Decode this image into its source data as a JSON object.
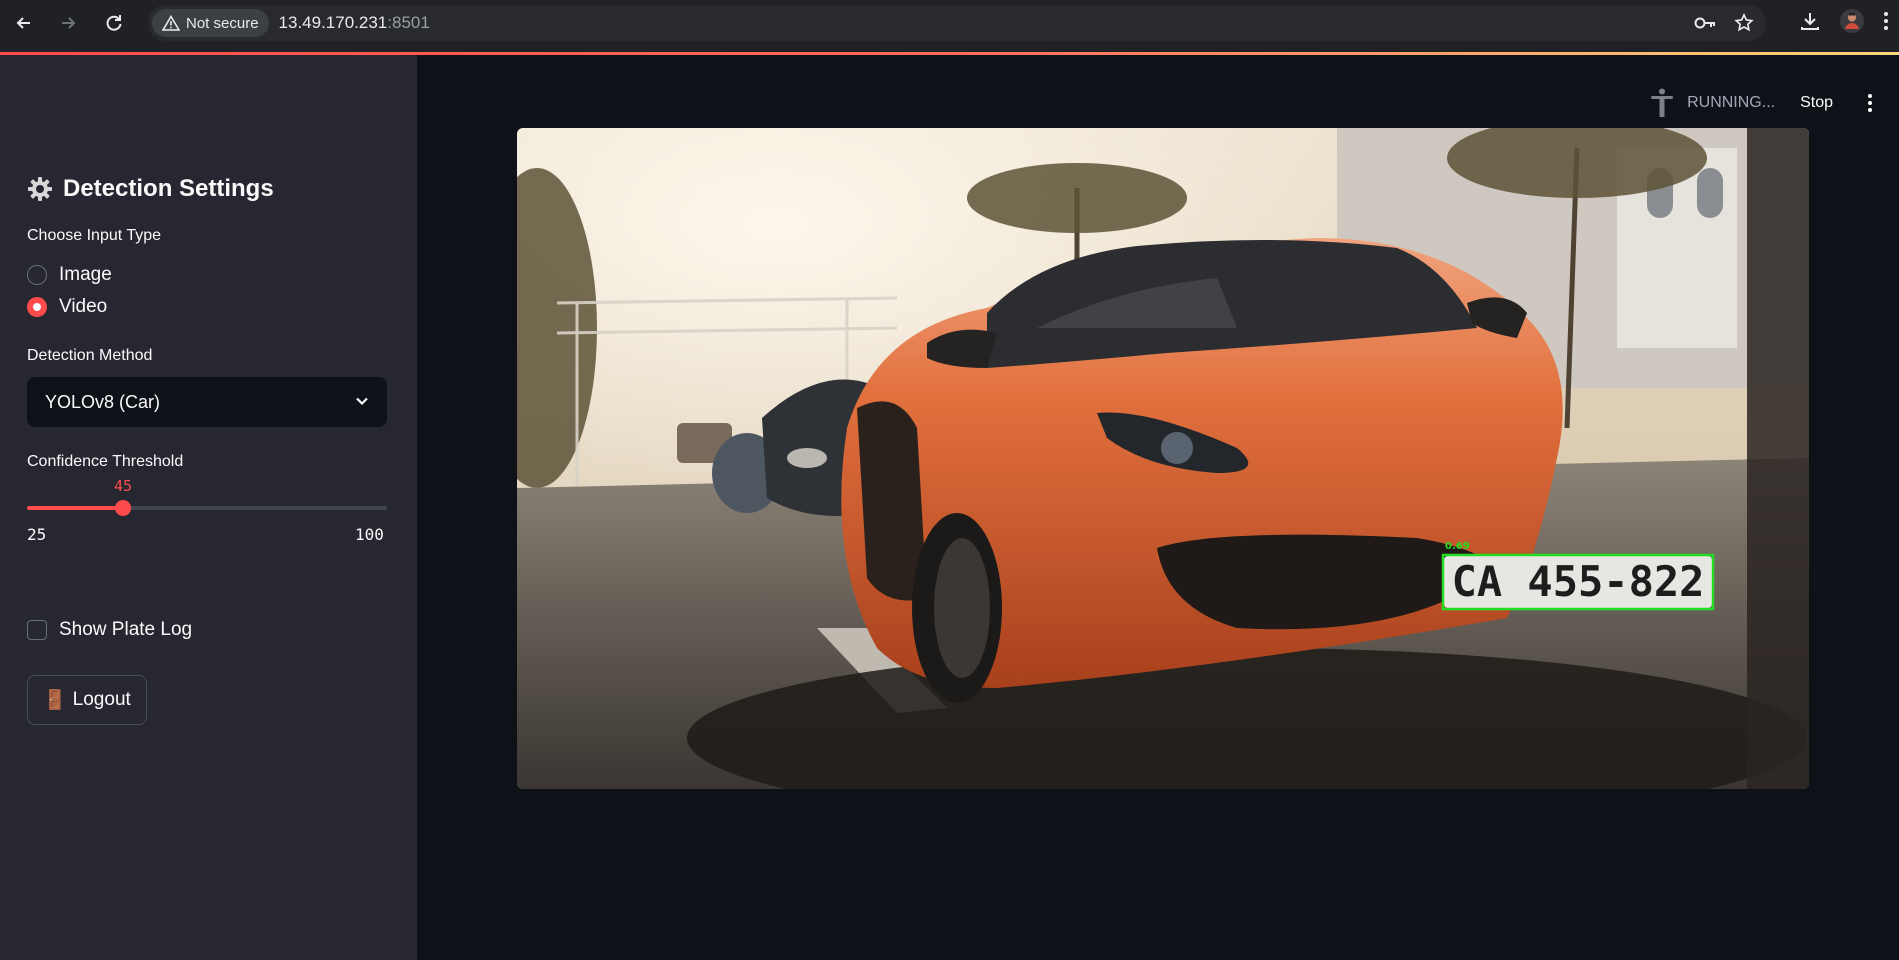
{
  "browser": {
    "security_label": "Not secure",
    "url_host": "13.49.170.231",
    "url_port": ":8501"
  },
  "sidebar": {
    "title": "Detection Settings",
    "input_type_label": "Choose Input Type",
    "input_options": [
      "Image",
      "Video"
    ],
    "input_selected": "Video",
    "method_label": "Detection Method",
    "method_value": "YOLOv8 (Car)",
    "confidence_label": "Confidence Threshold",
    "confidence_value": 45,
    "confidence_min": 25,
    "confidence_max": 100,
    "show_plate_log_label": "Show Plate Log",
    "show_plate_log_checked": false,
    "logout_icon": "🚪",
    "logout_label": "Logout"
  },
  "status": {
    "running_text": "RUNNING...",
    "stop_label": "Stop"
  },
  "frame": {
    "plate_text": "CA 455-822",
    "detection_confidence": "0.69"
  },
  "colors": {
    "accent": "#ff4b4b",
    "sidebar_bg": "#262730",
    "main_bg": "#0e1117",
    "detection_box": "#22dd22"
  }
}
